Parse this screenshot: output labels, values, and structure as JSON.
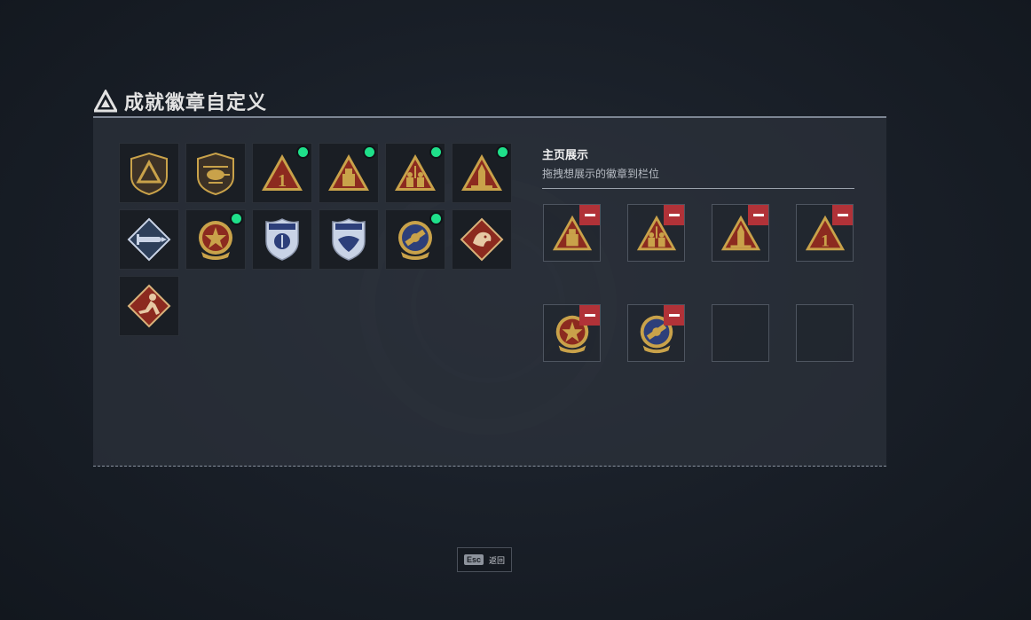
{
  "header": {
    "title": "成就徽章自定义",
    "icon": "triangle-logo-icon"
  },
  "badge_library": [
    {
      "icon": "shield-triangle-badge-icon",
      "new": false
    },
    {
      "icon": "helicopter-badge-icon",
      "new": false
    },
    {
      "icon": "triangle-number-one-badge-icon",
      "new": true
    },
    {
      "icon": "triangle-crate-badge-icon",
      "new": true
    },
    {
      "icon": "triangle-soldiers-badge-icon",
      "new": true
    },
    {
      "icon": "triangle-rocket-badge-icon",
      "new": true
    },
    {
      "icon": "diamond-missile-badge-icon",
      "new": false
    },
    {
      "icon": "star-medal-badge-icon",
      "new": true
    },
    {
      "icon": "police-shield-badge-icon",
      "new": false
    },
    {
      "icon": "police-eagle-badge-icon",
      "new": false
    },
    {
      "icon": "wrench-emblem-badge-icon",
      "new": true
    },
    {
      "icon": "dragon-diamond-badge-icon",
      "new": false
    },
    {
      "icon": "runner-diamond-badge-icon",
      "new": false
    }
  ],
  "display": {
    "title": "主页展示",
    "subtitle": "拖拽想展示的徽章到栏位",
    "slots": [
      {
        "icon": "triangle-crate-badge-icon",
        "filled": true
      },
      {
        "icon": "triangle-soldiers-badge-icon",
        "filled": true
      },
      {
        "icon": "triangle-rocket-badge-icon",
        "filled": true
      },
      {
        "icon": "triangle-number-one-badge-icon",
        "filled": true
      },
      {
        "icon": "star-medal-badge-icon",
        "filled": true
      },
      {
        "icon": "wrench-emblem-badge-icon",
        "filled": true
      },
      {
        "icon": "",
        "filled": false
      },
      {
        "icon": "",
        "filled": false
      }
    ]
  },
  "footer": {
    "key": "Esc",
    "label": "返回"
  },
  "colors": {
    "new_dot": "#1fe08a",
    "remove": "#b13238",
    "gold": "#c9a24a",
    "badge_red": "#8c2a1f"
  }
}
